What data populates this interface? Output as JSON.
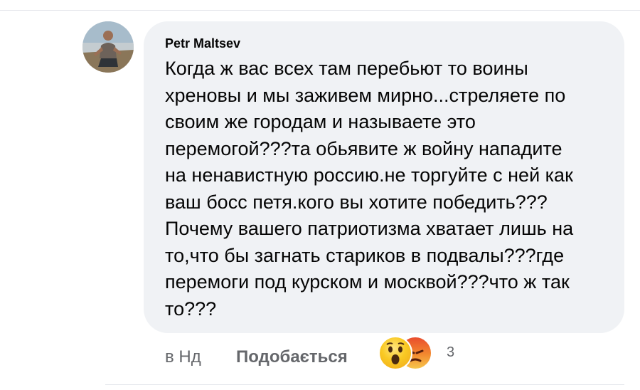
{
  "comment": {
    "author": "Petr  Maltsev",
    "lines": [
      "Когда ж вас всех там перебьют то воины",
      "хреновы и мы заживем мирно...стреляете по",
      "своим же городам и называете это",
      "перемогой???та обьявите ж войну нападите",
      "на ненавистную россию.не торгуйте с ней как",
      "ваш босс петя.кого вы хотите победить???",
      "Почему вашего патриотизма хватает лишь на",
      "то,что бы загнать стариков в подвалы???где",
      "перемоги под курском и москвой???что ж так",
      "то???"
    ],
    "timestamp": "в Нд",
    "like_label": "Подобається",
    "reactions": [
      "wow-reaction-icon",
      "angry-reaction-icon"
    ],
    "reaction_count": "3"
  },
  "colors": {
    "bubble_bg": "#f0f2f5",
    "text": "#050505",
    "secondary_text": "#65676b"
  }
}
